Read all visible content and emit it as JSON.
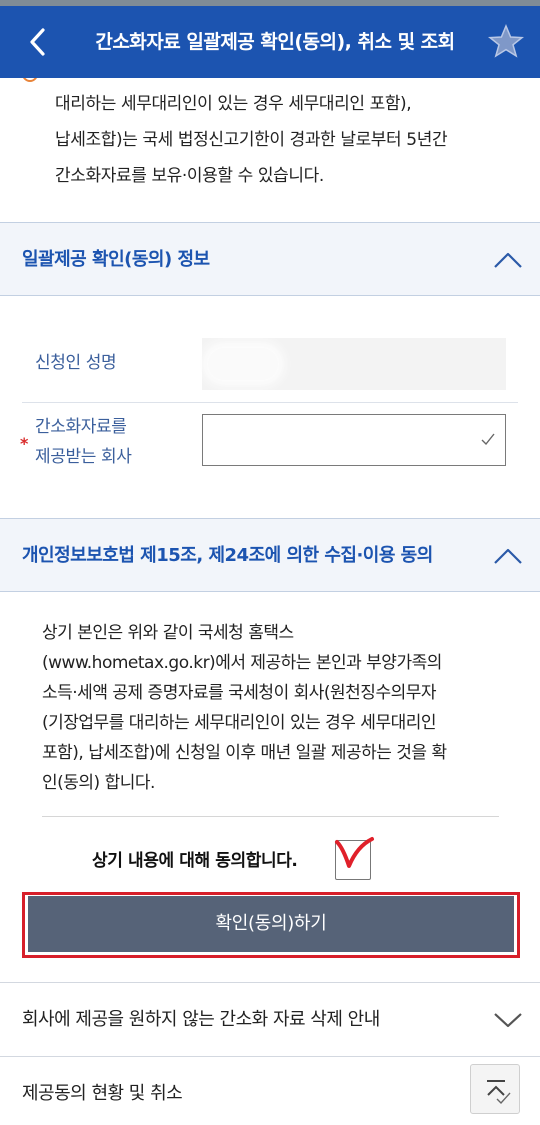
{
  "header": {
    "title": "간소화자료 일괄제공 확인(동의), 취소 및 조회"
  },
  "intro": {
    "lines": [
      "대리하는 세무대리인이 있는 경우 세무대리인 포함),",
      "납세조합)는 국세 법정신고기한이 경과한 날로부터 5년간",
      "간소화자료를 보유·이용할 수 있습니다."
    ]
  },
  "section_info": {
    "title": "일괄제공 확인(동의) 정보"
  },
  "form": {
    "name_label": "신청인 성명",
    "company_label_line1": "간소화자료를",
    "company_label_line2": "제공받는 회사",
    "required_mark": "*"
  },
  "section_consent": {
    "title": "개인정보보호법 제15조, 제24조에 의한 수집·이용 동의"
  },
  "consent": {
    "lines": [
      "상기 본인은 위와 같이 국세청 홈택스",
      "(www.hometax.go.kr)에서 제공하는 본인과 부양가족의",
      "소득·세액 공제 증명자료를 국세청이 회사(원천징수의무자",
      "(기장업무를 대리하는 세무대리인이 있는 경우 세무대리인",
      "포함), 납세조합)에 신청일 이후 매년 일괄 제공하는 것을 확",
      "인(동의) 합니다."
    ],
    "agree_label": "상기 내용에 대해 동의합니다.",
    "agreed": true
  },
  "confirm_button": {
    "label": "확인(동의)하기"
  },
  "list": {
    "delete_guide": "회사에 제공을 원하지 않는 간소화 자료 삭제 안내",
    "status_cancel": "제공동의 현황 및 취소"
  },
  "icons": {
    "back": "chevron-left-icon",
    "favorite": "star-icon",
    "collapse": "chevron-up-icon",
    "expand": "chevron-down-icon",
    "scroll_top": "scroll-top-icon"
  },
  "colors": {
    "header_bg": "#1c54b0",
    "section_title": "#1c54b0",
    "button_bg": "#566378",
    "highlight_outline": "#d71f2a",
    "check_mark": "#e0202a"
  }
}
